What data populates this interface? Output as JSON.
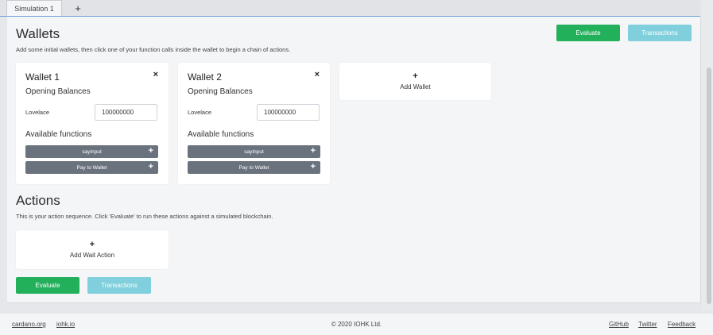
{
  "tabs": [
    {
      "label": "Simulation 1"
    }
  ],
  "tab_add": "+",
  "wallets": {
    "title": "Wallets",
    "description": "Add some initial wallets, then click one of your function calls inside the wallet to begin a chain of actions.",
    "evaluate_label": "Evaluate",
    "transactions_label": "Transactions",
    "items": [
      {
        "title": "Wallet 1",
        "close": "×",
        "opening_label": "Opening Balances",
        "currency": "Lovelace",
        "amount": "100000000",
        "functions_label": "Available functions",
        "functions": [
          "sayInput",
          "Pay to Wallet"
        ]
      },
      {
        "title": "Wallet 2",
        "close": "×",
        "opening_label": "Opening Balances",
        "currency": "Lovelace",
        "amount": "100000000",
        "functions_label": "Available functions",
        "functions": [
          "sayInput",
          "Pay to Wallet"
        ]
      }
    ],
    "add_plus": "+",
    "add_label": "Add Wallet"
  },
  "actions": {
    "title": "Actions",
    "description": "This is your action sequence. Click 'Evaluate' to run these actions against a simulated blockchain.",
    "add_plus": "+",
    "add_label": "Add Wait Action",
    "evaluate_label": "Evaluate",
    "transactions_label": "Transactions"
  },
  "fn_plus": "+",
  "footer": {
    "left_links": [
      "cardano.org",
      "iohk.io"
    ],
    "copyright": "© 2020 IOHK Ltd.",
    "right_links": [
      "GitHub",
      "Twitter",
      "Feedback"
    ]
  },
  "colors": {
    "evaluate": "#23b05b",
    "transactions": "#7fd0dc",
    "function_button": "#6a737d",
    "tab_underline": "#6d9fd6"
  }
}
